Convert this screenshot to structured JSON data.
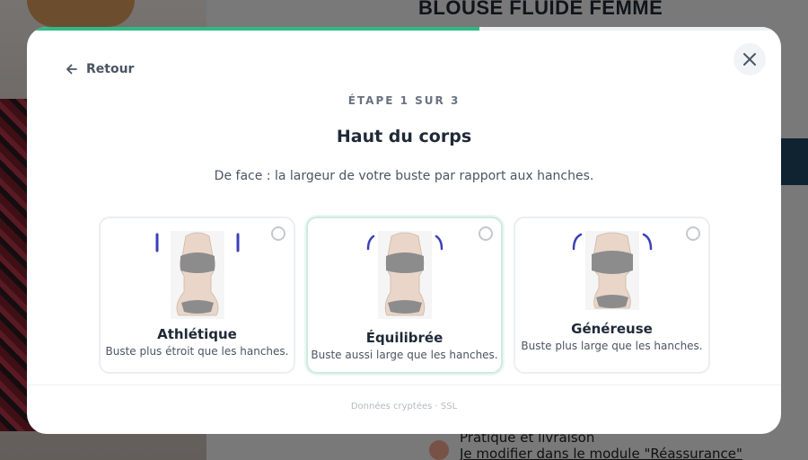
{
  "background": {
    "product_title": "BLOUSE FLUIDE FEMME",
    "note_line1": "Pratique et livraison",
    "note_line2": "Je modifier dans le module \"Réassurance\""
  },
  "modal": {
    "progress_percent": 60,
    "progress_color": "#2fb985",
    "back_label": "Retour",
    "back_icon": "arrow-left-icon",
    "close_icon": "close-icon",
    "step": "ÉTAPE 1 SUR 3",
    "title": "Haut du corps",
    "subtitle": "De face : la largeur de votre buste par rapport aux hanches.",
    "options": [
      {
        "name": "Athlétique",
        "desc": "Buste plus étroit que les hanches.",
        "selected": false,
        "accent": "#3b3fb8"
      },
      {
        "name": "Équilibrée",
        "desc": "Buste aussi large que les hanches.",
        "selected": true,
        "accent": "#3b3fb8"
      },
      {
        "name": "Généreuse",
        "desc": "Buste plus large que les hanches.",
        "selected": false,
        "accent": "#3b3fb8"
      }
    ],
    "footer": "Données cryptées · SSL"
  }
}
